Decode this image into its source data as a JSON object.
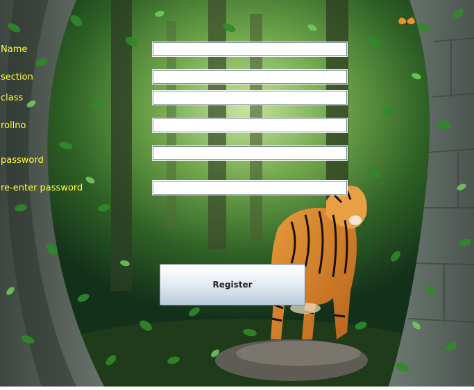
{
  "form": {
    "fields": [
      {
        "label": "Name",
        "value": ""
      },
      {
        "label": "section",
        "value": ""
      },
      {
        "label": "class",
        "value": ""
      },
      {
        "label": "rollno",
        "value": ""
      },
      {
        "label": "password",
        "value": ""
      },
      {
        "label": "re-enter password",
        "value": ""
      }
    ],
    "register_label": "Register"
  },
  "colors": {
    "label_text": "#ffff33",
    "jungle_dark": "#0f2a12",
    "jungle_mid": "#2f6a2a",
    "jungle_light": "#8fc070",
    "stone": "#5b625c",
    "tiger_orange": "#d8842a"
  },
  "background": {
    "scene": "jungle-tiger-stone-arch"
  }
}
